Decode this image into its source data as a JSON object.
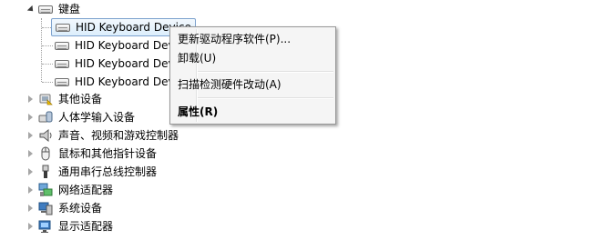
{
  "tree": {
    "keyboard_category": {
      "label": "键盘",
      "expanded": true
    },
    "keyboard_devices": [
      {
        "label": "HID Keyboard Device",
        "selected": true
      },
      {
        "label": "HID Keyboard Device",
        "selected": false
      },
      {
        "label": "HID Keyboard Device",
        "selected": false
      },
      {
        "label": "HID Keyboard Device",
        "selected": false
      }
    ],
    "categories": [
      {
        "label": "其他设备",
        "icon": "other-devices-icon"
      },
      {
        "label": "人体学输入设备",
        "icon": "hid-icon"
      },
      {
        "label": "声音、视频和游戏控制器",
        "icon": "speaker-icon"
      },
      {
        "label": "鼠标和其他指针设备",
        "icon": "mouse-icon"
      },
      {
        "label": "通用串行总线控制器",
        "icon": "usb-icon"
      },
      {
        "label": "网络适配器",
        "icon": "network-adapter-icon"
      },
      {
        "label": "系统设备",
        "icon": "system-devices-icon"
      },
      {
        "label": "显示适配器",
        "icon": "display-adapter-icon"
      }
    ]
  },
  "context_menu": {
    "update_driver": "更新驱动程序软件(P)...",
    "uninstall": "卸载(U)",
    "scan_hardware": "扫描检测硬件改动(A)",
    "properties": "属性(R)"
  }
}
